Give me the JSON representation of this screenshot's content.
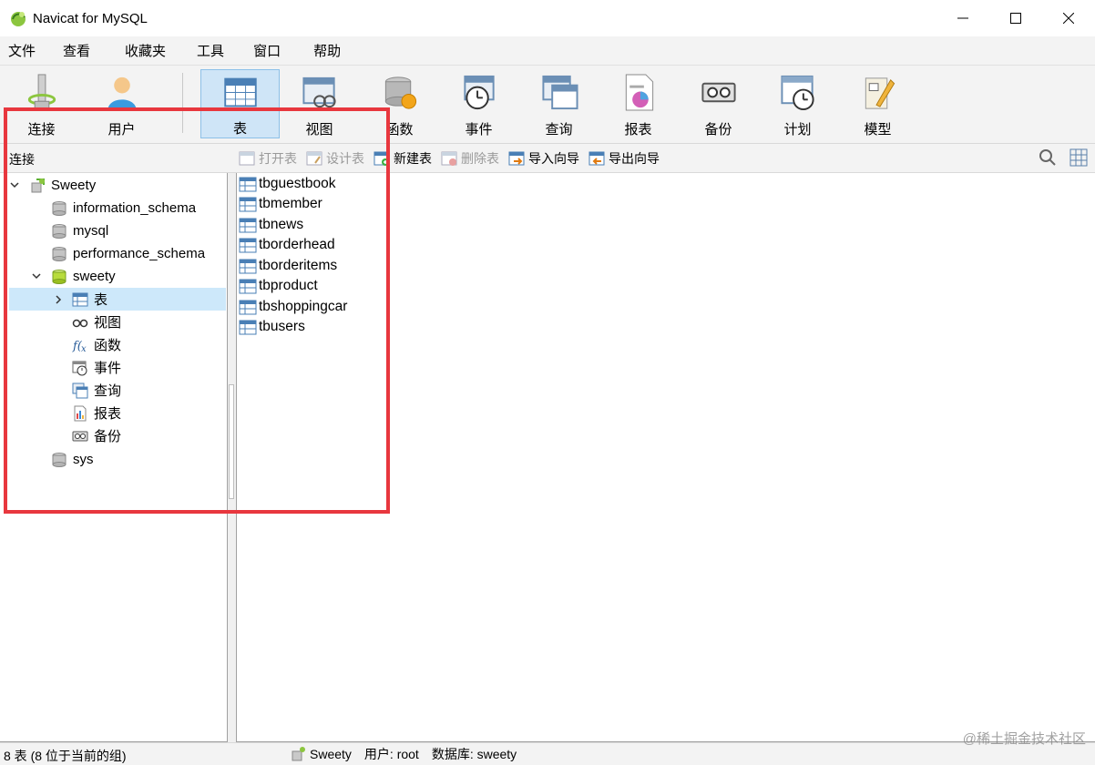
{
  "window": {
    "title": "Navicat for MySQL"
  },
  "menu": [
    "文件",
    "查看",
    "收藏夹",
    "工具",
    "窗口",
    "帮助"
  ],
  "toolbar": [
    {
      "label": "连接",
      "icon": "connection-icon"
    },
    {
      "label": "用户",
      "icon": "user-icon"
    },
    {
      "label": "表",
      "icon": "table-icon",
      "active": true
    },
    {
      "label": "视图",
      "icon": "view-icon"
    },
    {
      "label": "函数",
      "icon": "function-icon"
    },
    {
      "label": "事件",
      "icon": "event-icon"
    },
    {
      "label": "查询",
      "icon": "query-icon"
    },
    {
      "label": "报表",
      "icon": "report-icon"
    },
    {
      "label": "备份",
      "icon": "backup-icon"
    },
    {
      "label": "计划",
      "icon": "schedule-icon"
    },
    {
      "label": "模型",
      "icon": "model-icon"
    }
  ],
  "subbar": {
    "left_label": "连接",
    "actions": [
      {
        "label": "打开表",
        "enabled": false
      },
      {
        "label": "设计表",
        "enabled": false
      },
      {
        "label": "新建表",
        "enabled": true
      },
      {
        "label": "删除表",
        "enabled": false
      },
      {
        "label": "导入向导",
        "enabled": true
      },
      {
        "label": "导出向导",
        "enabled": true
      }
    ]
  },
  "tree": {
    "connection": "Sweety",
    "databases": [
      "information_schema",
      "mysql",
      "performance_schema",
      "sweety",
      "sys"
    ],
    "sweety_children": [
      "表",
      "视图",
      "函数",
      "事件",
      "查询",
      "报表",
      "备份"
    ]
  },
  "tables": [
    "tbguestbook",
    "tbmember",
    "tbnews",
    "tborderhead",
    "tborderitems",
    "tbproduct",
    "tbshoppingcar",
    "tbusers"
  ],
  "status": {
    "left": "8 表 (8 位于当前的组)",
    "connection": "Sweety",
    "user": "用户: root",
    "database": "数据库: sweety"
  },
  "watermark": "@稀土掘金技术社区",
  "colors": {
    "highlight": "#e8373e",
    "selection": "#cde8fa",
    "active_tool": "#cfe5f7"
  }
}
